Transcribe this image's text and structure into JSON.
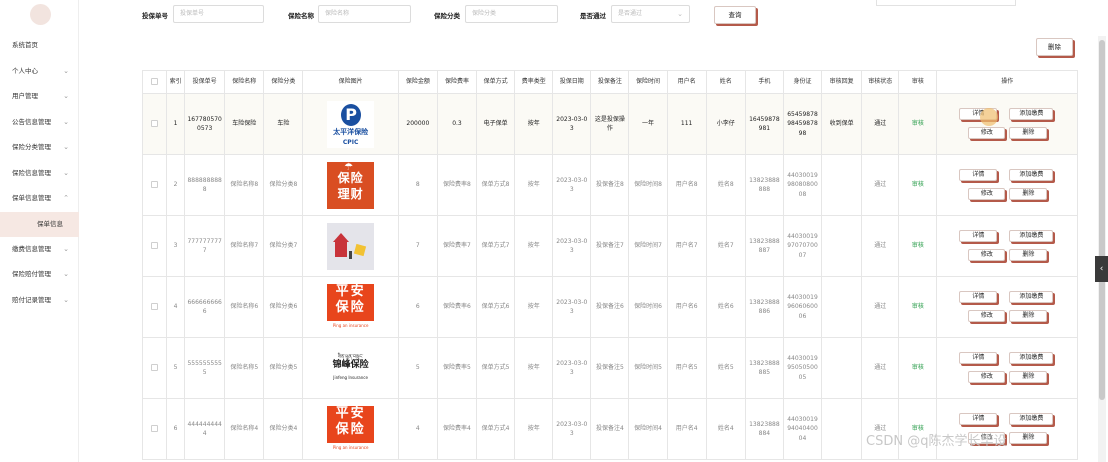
{
  "sidebar": {
    "items": [
      {
        "label": "系统首页",
        "has_chevron": false
      },
      {
        "label": "个人中心",
        "has_chevron": true
      },
      {
        "label": "用户管理",
        "has_chevron": true
      },
      {
        "label": "公告信息管理",
        "has_chevron": true
      },
      {
        "label": "保险分类管理",
        "has_chevron": true
      },
      {
        "label": "保险信息管理",
        "has_chevron": true
      },
      {
        "label": "保单信息管理",
        "has_chevron": true,
        "expanded": true
      },
      {
        "label": "缴费信息管理",
        "has_chevron": true
      },
      {
        "label": "保险赔付管理",
        "has_chevron": true
      },
      {
        "label": "赔付记录管理",
        "has_chevron": true
      }
    ],
    "sub_item": "保单信息",
    "chevron_down": "⌄",
    "chevron_up": "⌃"
  },
  "search": {
    "policy_no_label": "投保单号",
    "policy_no_placeholder": "投保单号",
    "insurance_name_label": "保险名称",
    "insurance_name_placeholder": "保险名称",
    "category_label": "保险分类",
    "category_placeholder": "保险分类",
    "approved_label": "是否通过",
    "approved_placeholder": "是否通过",
    "query_button": "查询"
  },
  "toolbar": {
    "delete_button": "删除"
  },
  "table": {
    "headers": [
      "",
      "索引",
      "投保单号",
      "保险名称",
      "保险分类",
      "保险图片",
      "保险金额",
      "保险费率",
      "保单方式",
      "费率类型",
      "投保日期",
      "投保备注",
      "保险时间",
      "用户名",
      "姓名",
      "手机",
      "身份证",
      "审核回复",
      "审核状态",
      "审核",
      "操作"
    ],
    "op_labels": {
      "detail": "详情",
      "add_payment": "添加缴费",
      "edit": "修改",
      "delete": "删除"
    },
    "rows": [
      {
        "index": "1",
        "policy_no": "1677805700573",
        "name": "车险保险",
        "category": "车险",
        "logo": "cpic",
        "logo_t1": "太平洋保险",
        "logo_t2": "CPIC",
        "amount": "200000",
        "rate": "0.3",
        "method": "电子保单",
        "rate_type": "按年",
        "date": "2023-03-03",
        "note": "这是投保操作",
        "duration": "一年",
        "username": "111",
        "realname": "小李仔",
        "phone": "16459878981",
        "id_card": "654598789845987898",
        "reply": "收到保单",
        "status": "通过",
        "audit": "审核"
      },
      {
        "index": "2",
        "policy_no": "8888888888",
        "name": "保险名称8",
        "category": "保险分类8",
        "logo": "licai",
        "logo_t1": "保险",
        "logo_t2": "理财",
        "amount": "8",
        "rate": "保险费率8",
        "method": "保单方式8",
        "rate_type": "按年",
        "date": "2023-03-03",
        "note": "投保备注8",
        "duration": "保险时间8",
        "username": "用户名8",
        "realname": "姓名8",
        "phone": "13823888888",
        "id_card": "440300199808080008",
        "reply": "",
        "status": "通过",
        "audit": "审核"
      },
      {
        "index": "3",
        "policy_no": "7777777777",
        "name": "保险名称7",
        "category": "保险分类7",
        "logo": "photo",
        "logo_t1": "",
        "logo_t2": "",
        "amount": "7",
        "rate": "保险费率7",
        "method": "保单方式7",
        "rate_type": "按年",
        "date": "2023-03-03",
        "note": "投保备注7",
        "duration": "保险时间7",
        "username": "用户名7",
        "realname": "姓名7",
        "phone": "13823888887",
        "id_card": "440300199707070007",
        "reply": "",
        "status": "通过",
        "audit": "审核"
      },
      {
        "index": "4",
        "policy_no": "6666666666",
        "name": "保险名称6",
        "category": "保险分类6",
        "logo": "ping",
        "logo_t1": "平安",
        "logo_t2": "保险",
        "logo_t3": "Ping an insurance",
        "amount": "6",
        "rate": "保险费率6",
        "method": "保单方式6",
        "rate_type": "按年",
        "date": "2023-03-03",
        "note": "投保备注6",
        "duration": "保险时间6",
        "username": "用户名6",
        "realname": "姓名6",
        "phone": "13823888886",
        "id_card": "440300199606060006",
        "reply": "",
        "status": "通过",
        "audit": "审核"
      },
      {
        "index": "5",
        "policy_no": "5555555555",
        "name": "保险名称5",
        "category": "保险分类5",
        "logo": "jinfeng",
        "logo_t1": "ཟིན་ཕུན་བསྲུང་",
        "logo_t2": "锦峰保险",
        "logo_t3": "Jinfeng Insurance",
        "amount": "5",
        "rate": "保险费率5",
        "method": "保单方式5",
        "rate_type": "按年",
        "date": "2023-03-03",
        "note": "投保备注5",
        "duration": "保险时间5",
        "username": "用户名5",
        "realname": "姓名5",
        "phone": "13823888885",
        "id_card": "440300199505050005",
        "reply": "",
        "status": "通过",
        "audit": "审核"
      },
      {
        "index": "6",
        "policy_no": "4444444444",
        "name": "保险名称4",
        "category": "保险分类4",
        "logo": "ping",
        "logo_t1": "平安",
        "logo_t2": "保险",
        "logo_t3": "Ping an insurance",
        "amount": "4",
        "rate": "保险费率4",
        "method": "保单方式4",
        "rate_type": "按年",
        "date": "2023-03-03",
        "note": "投保备注4",
        "duration": "保险时间4",
        "username": "用户名4",
        "realname": "姓名4",
        "phone": "13823888884",
        "id_card": "440300199404040004",
        "reply": "",
        "status": "通过",
        "audit": "审核"
      }
    ]
  },
  "side_tab_label": "‹",
  "watermark": "CSDN @q陈杰学长毕设",
  "colors": {
    "accent_shadow": "#b45a4a",
    "active_menu_bg": "#f6e8e3",
    "audit_green": "#2a9d4b"
  }
}
